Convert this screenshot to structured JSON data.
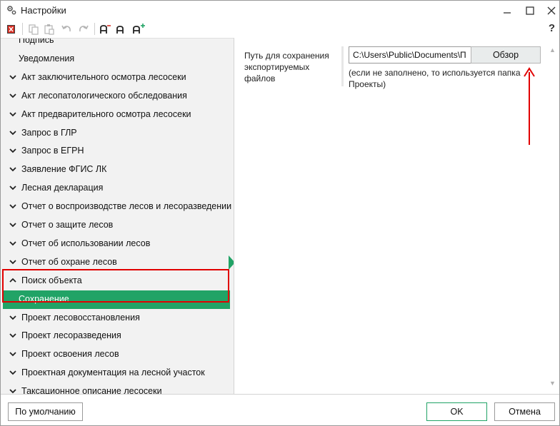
{
  "window": {
    "title": "Настройки",
    "help_label": "?"
  },
  "tree": {
    "items": [
      {
        "label": "Подпись",
        "kind": "sub"
      },
      {
        "label": "Уведомления",
        "kind": "sub"
      },
      {
        "label": "Акт заключительного осмотра лесосеки",
        "kind": "collapsed"
      },
      {
        "label": "Акт лесопатологического обследования",
        "kind": "collapsed"
      },
      {
        "label": "Акт предварительного осмотра лесосеки",
        "kind": "collapsed"
      },
      {
        "label": "Запрос в ГЛР",
        "kind": "collapsed"
      },
      {
        "label": "Запрос в ЕГРН",
        "kind": "collapsed"
      },
      {
        "label": "Заявление ФГИС ЛК",
        "kind": "collapsed"
      },
      {
        "label": "Лесная декларация",
        "kind": "collapsed"
      },
      {
        "label": "Отчет о воспроизводстве лесов и лесоразведении",
        "kind": "collapsed"
      },
      {
        "label": "Отчет о защите лесов",
        "kind": "collapsed"
      },
      {
        "label": "Отчет об использовании лесов",
        "kind": "collapsed"
      },
      {
        "label": "Отчет об охране лесов",
        "kind": "collapsed"
      },
      {
        "label": "Поиск объекта",
        "kind": "expanded"
      },
      {
        "label": "Сохранение",
        "kind": "selected"
      },
      {
        "label": "Проект лесовосстановления",
        "kind": "collapsed"
      },
      {
        "label": "Проект лесоразведения",
        "kind": "collapsed"
      },
      {
        "label": "Проект освоения лесов",
        "kind": "collapsed"
      },
      {
        "label": "Проектная документация на лесной участок",
        "kind": "collapsed"
      },
      {
        "label": "Таксационное описание лесосеки",
        "kind": "collapsed"
      }
    ]
  },
  "settings": {
    "path_label": "Путь для сохранения экспортируемых файлов",
    "path_value": "C:\\Users\\Public\\Documents\\П",
    "browse_label": "Обзор",
    "hint": "(если не заполнено, то используется папка Проекты)"
  },
  "footer": {
    "default_label": "По умолчанию",
    "ok_label": "OK",
    "cancel_label": "Отмена"
  },
  "colors": {
    "selection": "#21a366",
    "highlight": "#e10000",
    "annotation_arrow": "#e10000"
  }
}
